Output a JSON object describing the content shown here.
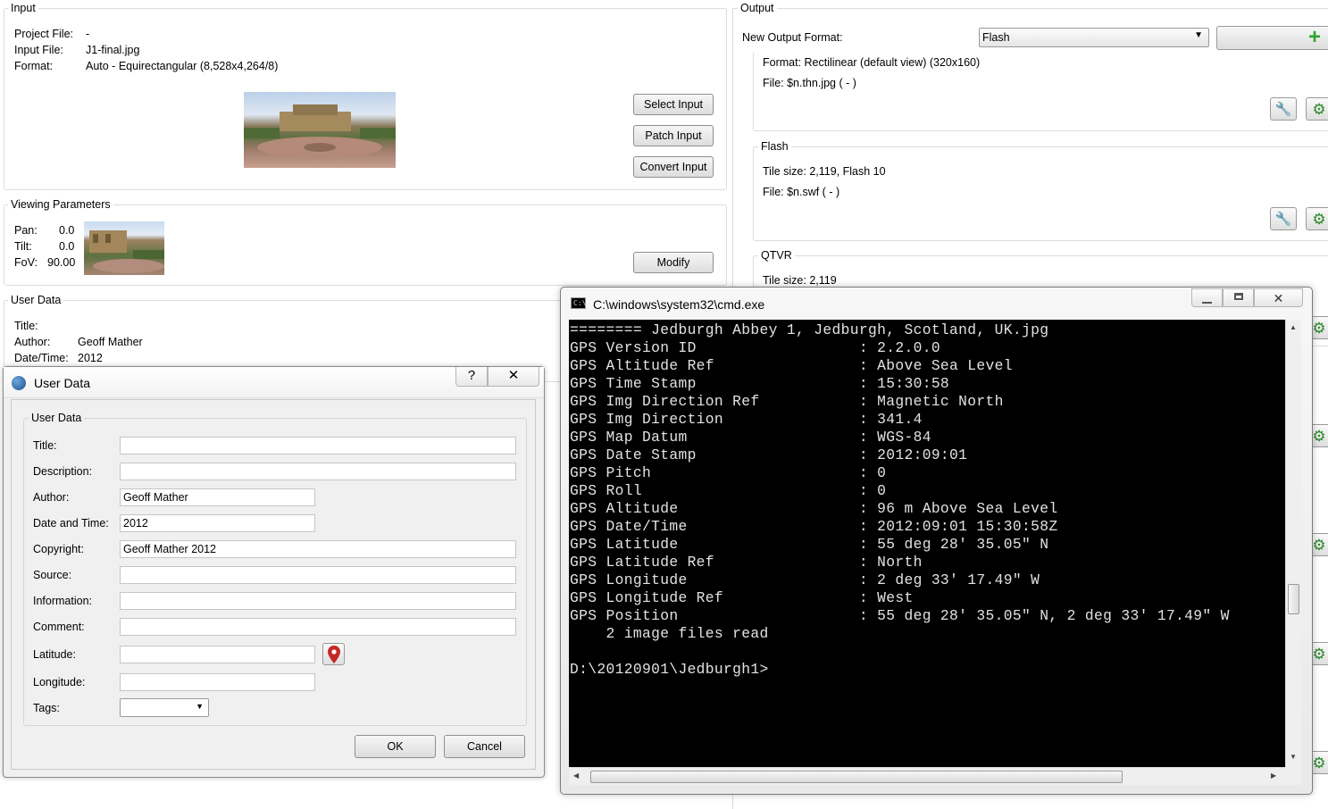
{
  "input": {
    "legend": "Input",
    "project_file_label": "Project File:",
    "project_file_value": "-",
    "input_file_label": "Input File:",
    "input_file_value": "J1-final.jpg",
    "format_label": "Format:",
    "format_value": "Auto - Equirectangular (8,528x4,264/8)",
    "select_input": "Select Input",
    "patch_input": "Patch Input",
    "convert_input": "Convert Input"
  },
  "viewing": {
    "legend": "Viewing Parameters",
    "pan_label": "Pan:",
    "pan_value": "0.0",
    "tilt_label": "Tilt:",
    "tilt_value": "0.0",
    "fov_label": "FoV:",
    "fov_value": "90.00",
    "modify": "Modify"
  },
  "user_data_panel": {
    "legend": "User Data",
    "title_label": "Title:",
    "author_label": "Author:",
    "author_value": "Geoff Mather",
    "datetime_label": "Date/Time:",
    "datetime_value": "2012"
  },
  "output": {
    "legend": "Output",
    "new_format_label": "New Output Format:",
    "new_format_value": "Flash",
    "default_view_format": "Format: Rectilinear (default view) (320x160)",
    "default_view_file": "File: $n.thn.jpg ( - )",
    "flash_legend": "Flash",
    "flash_tile": "Tile size: 2,119, Flash 10",
    "flash_file": "File: $n.swf ( - )",
    "qtvr_legend": "QTVR",
    "qtvr_tile": "Tile size: 2,119"
  },
  "dialog": {
    "title": "User Data",
    "group_legend": "User Data",
    "help_icon": "question-mark-icon",
    "close_icon": "close-icon",
    "fields": {
      "title": {
        "label": "Title:",
        "value": ""
      },
      "description": {
        "label": "Description:",
        "value": ""
      },
      "author": {
        "label": "Author:",
        "value": "Geoff Mather"
      },
      "datetime": {
        "label": "Date and Time:",
        "value": "2012"
      },
      "copyright": {
        "label": "Copyright:",
        "value": "Geoff Mather 2012"
      },
      "source": {
        "label": "Source:",
        "value": ""
      },
      "information": {
        "label": "Information:",
        "value": ""
      },
      "comment": {
        "label": "Comment:",
        "value": ""
      },
      "latitude": {
        "label": "Latitude:",
        "value": ""
      },
      "longitude": {
        "label": "Longitude:",
        "value": ""
      },
      "tags": {
        "label": "Tags:",
        "value": ""
      }
    },
    "ok": "OK",
    "cancel": "Cancel"
  },
  "cmd": {
    "title": "C:\\windows\\system32\\cmd.exe",
    "lines": [
      "======== Jedburgh Abbey 1, Jedburgh, Scotland, UK.jpg",
      "GPS Version ID                  : 2.2.0.0",
      "GPS Altitude Ref                : Above Sea Level",
      "GPS Time Stamp                  : 15:30:58",
      "GPS Img Direction Ref           : Magnetic North",
      "GPS Img Direction               : 341.4",
      "GPS Map Datum                   : WGS-84",
      "GPS Date Stamp                  : 2012:09:01",
      "GPS Pitch                       : 0",
      "GPS Roll                        : 0",
      "GPS Altitude                    : 96 m Above Sea Level",
      "GPS Date/Time                   : 2012:09:01 15:30:58Z",
      "GPS Latitude                    : 55 deg 28' 35.05\" N",
      "GPS Latitude Ref                : North",
      "GPS Longitude                   : 2 deg 33' 17.49\" W",
      "GPS Longitude Ref               : West",
      "GPS Position                    : 55 deg 28' 35.05\" N, 2 deg 33' 17.49\" W",
      "    2 image files read",
      "",
      "D:\\20120901\\Jedburgh1>"
    ]
  }
}
